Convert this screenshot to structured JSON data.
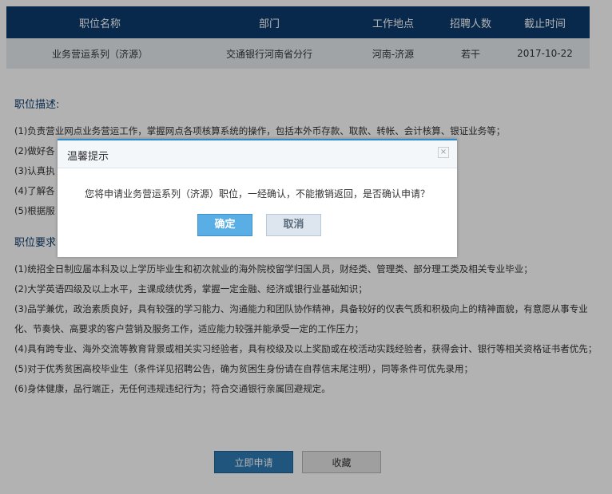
{
  "table": {
    "headers": [
      "职位名称",
      "部门",
      "工作地点",
      "招聘人数",
      "截止时间"
    ],
    "row": [
      "业务营运系列（济源）",
      "交通银行河南省分行",
      "河南-济源",
      "若干",
      "2017-10-22"
    ]
  },
  "description": {
    "title": "职位描述:",
    "items": [
      "(1)负责营业网点业务营运工作，掌握网点各项核算系统的操作，包括本外币存款、取款、转帐、会计核算、银证业务等；",
      "(2)做好各",
      "(3)认真执",
      "(4)了解各",
      "(5)根据服"
    ]
  },
  "requirements": {
    "title": "职位要求",
    "items": [
      "(1)统招全日制应届本科及以上学历毕业生和初次就业的海外院校留学归国人员，财经类、管理类、部分理工类及相关专业毕业；",
      "(2)大学英语四级及以上水平，主课成绩优秀，掌握一定金融、经济或银行业基础知识；",
      "(3)品学兼优，政治素质良好，具有较强的学习能力、沟通能力和团队协作精神，具备较好的仪表气质和积极向上的精神面貌，有意愿从事专业化、节奏快、高要求的客户营销及服务工作，适应能力较强并能承受一定的工作压力；",
      "(4)具有跨专业、海外交流等教育背景或相关实习经验者，具有校级及以上奖励或在校活动实践经验者，获得会计、银行等相关资格证书者优先；",
      "(5)对于优秀贫困高校毕业生（条件详见招聘公告，确为贫困生身份请在自荐信末尾注明），同等条件可优先录用；",
      "(6)身体健康，品行端正，无任何违规违纪行为；符合交通银行亲属回避规定。"
    ]
  },
  "actions": {
    "apply": "立即申请",
    "favorite": "收藏"
  },
  "dialog": {
    "title": "温馨提示",
    "close": "×",
    "message": "您将申请业务营运系列（济源）职位，一经确认，不能撤销返回，是否确认申请？",
    "confirm": "确定",
    "cancel": "取消"
  },
  "colors": {
    "header_bg": "#0c3c6e",
    "accent": "#2b8bd0",
    "overlay": "rgba(0,0,0,0.3)"
  }
}
